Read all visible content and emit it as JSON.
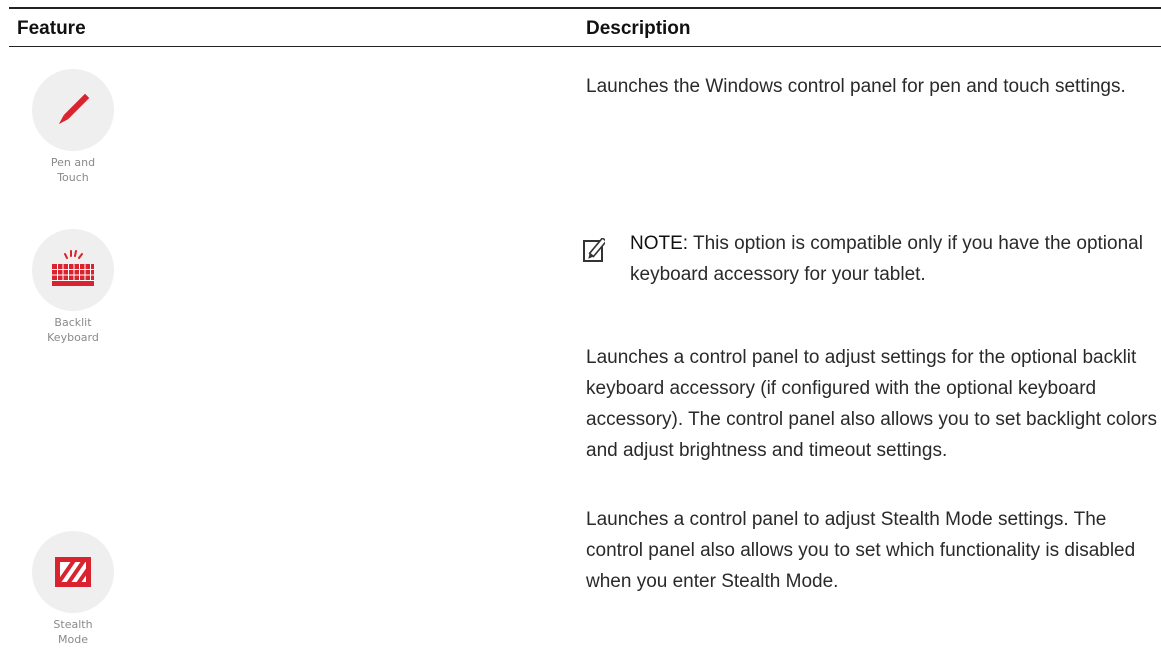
{
  "table": {
    "headers": {
      "feature": "Feature",
      "description": "Description"
    },
    "rows": [
      {
        "icon": "pen-icon",
        "label": "Pen and\nTouch",
        "description": "Launches the Windows control panel for pen and touch settings."
      },
      {
        "icon": "backlit-keyboard-icon",
        "label": "Backlit\nKeyboard",
        "note_label": "NOTE:",
        "note_text": " This option is compatible only if you have the optional keyboard accessory for your tablet.",
        "description": "Launches a control panel to adjust settings for the optional backlit keyboard accessory (if configured with the optional keyboard accessory). The control panel also allows you to set backlight colors and adjust brightness and timeout settings."
      },
      {
        "icon": "stealth-mode-icon",
        "label": "Stealth\nMode",
        "description": "Launches a control panel to adjust Stealth Mode settings. The control panel also allows you to set which functionality is disabled when you enter Stealth Mode."
      }
    ]
  },
  "colors": {
    "accent": "#d9232e",
    "icon_bg": "#efefef",
    "label_gray": "#8a8a8a"
  }
}
